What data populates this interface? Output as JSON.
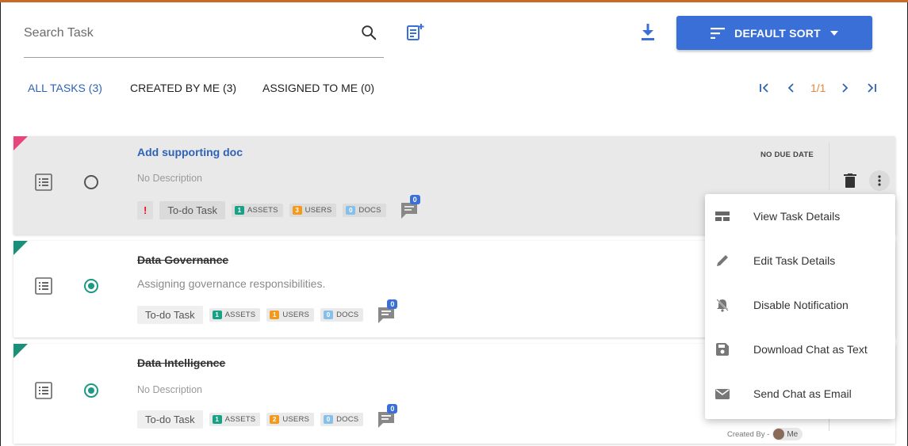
{
  "search": {
    "placeholder": "Search Task",
    "value": ""
  },
  "toolbar": {
    "sort_label": "DEFAULT SORT"
  },
  "tabs": [
    {
      "label": "ALL TASKS (3)",
      "active": true
    },
    {
      "label": "CREATED BY ME (3)",
      "active": false
    },
    {
      "label": "ASSIGNED TO ME (0)",
      "active": false
    }
  ],
  "pager": {
    "text": "1/1"
  },
  "tasks": [
    {
      "title": "Add supporting doc",
      "description": "No Description",
      "priority": "!",
      "type": "To-do Task",
      "assets": {
        "count": "1",
        "label": "ASSETS"
      },
      "users": {
        "count": "3",
        "label": "USERS"
      },
      "docs": {
        "count": "0",
        "label": "DOCS"
      },
      "comments": "0",
      "due": "NO DUE DATE",
      "completed": false,
      "corner_color": "#e8457a"
    },
    {
      "title": "Data Governance",
      "description": "Assigning governance responsibilities.",
      "type": "To-do Task",
      "assets": {
        "count": "1",
        "label": "ASSETS"
      },
      "users": {
        "count": "1",
        "label": "USERS"
      },
      "docs": {
        "count": "0",
        "label": "DOCS"
      },
      "comments": "0",
      "completed": true,
      "corner_color": "#1a8f7a"
    },
    {
      "title": "Data Intelligence",
      "description": "No Description",
      "type": "To-do Task",
      "assets": {
        "count": "1",
        "label": "ASSETS"
      },
      "users": {
        "count": "2",
        "label": "USERS"
      },
      "docs": {
        "count": "0",
        "label": "DOCS"
      },
      "comments": "0",
      "completed": true,
      "corner_color": "#1a8f7a",
      "created_by_label": "Created By -",
      "created_by_name": "Me"
    }
  ],
  "menu": {
    "items": [
      {
        "label": "View Task Details",
        "icon": "view-list-icon"
      },
      {
        "label": "Edit Task Details",
        "icon": "pencil-icon"
      },
      {
        "label": "Disable Notification",
        "icon": "bell-off-icon"
      },
      {
        "label": "Download Chat as Text",
        "icon": "save-icon"
      },
      {
        "label": "Send Chat as Email",
        "icon": "mail-icon"
      }
    ]
  },
  "colors": {
    "accent": "#3a6fd8",
    "pager_text": "#e8863a",
    "assets": "#17a285",
    "users": "#f39a1e",
    "docs": "#86c0ea"
  }
}
